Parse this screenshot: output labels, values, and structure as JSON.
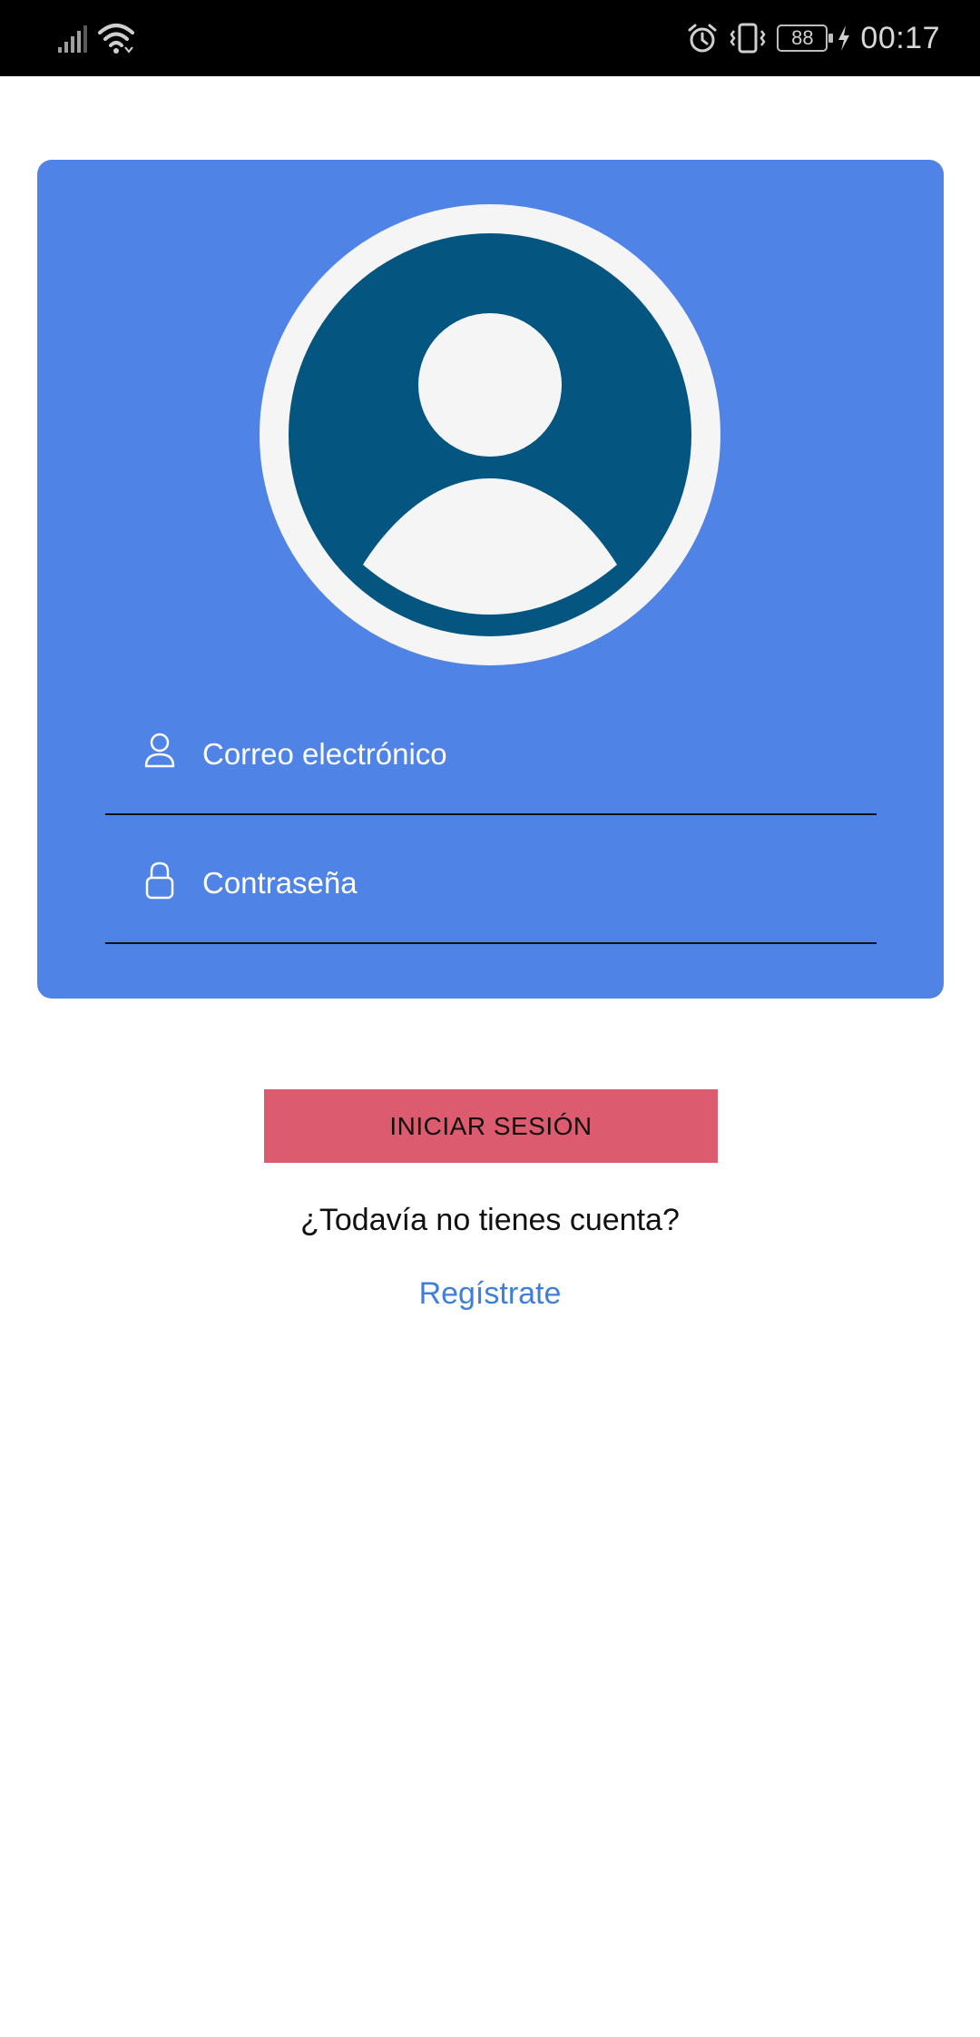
{
  "status_bar": {
    "time": "00:17",
    "battery": "88",
    "icons": [
      "signal-icon",
      "wifi-icon",
      "alarm-icon",
      "vibrate-icon",
      "battery-icon",
      "charging-icon"
    ]
  },
  "login_card": {
    "avatar": "user-avatar-icon",
    "email_placeholder": "Correo electrónico",
    "password_placeholder": "Contraseña"
  },
  "actions": {
    "login_label": "INICIAR SESIÓN",
    "no_account_text": "¿Todavía no tienes cuenta?",
    "register_link": "Regístrate"
  },
  "colors": {
    "card": "#5083e6",
    "avatar_circle": "#045580",
    "avatar_light": "#f5f5f6",
    "login_button": "#dd5b6e",
    "link": "#3f7fdc"
  }
}
